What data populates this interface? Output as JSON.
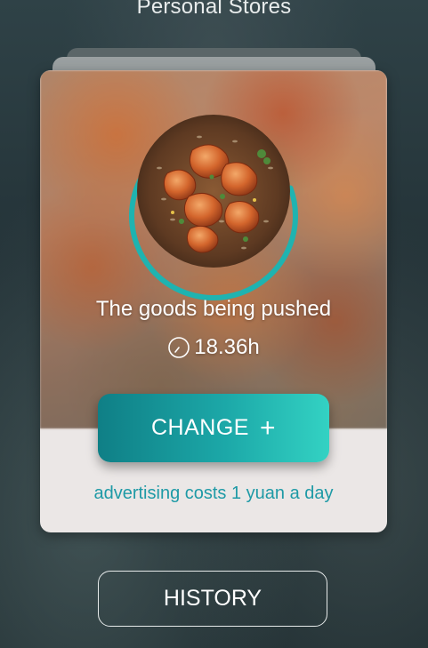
{
  "header": {
    "title": "Personal Stores"
  },
  "card": {
    "title": "The goods being pushed",
    "timer_value": "18.36h",
    "timer_icon": "clock-icon",
    "progress_fraction": 0.75,
    "change_label": "CHANGE",
    "change_icon": "plus-icon",
    "ad_note": "advertising costs 1 yuan a day"
  },
  "footer": {
    "history_label": "HISTORY"
  },
  "colors": {
    "accent_teal": "#1ca8a8",
    "ad_note_text": "#1e9aa6",
    "card_background": "#ebe7e6"
  }
}
